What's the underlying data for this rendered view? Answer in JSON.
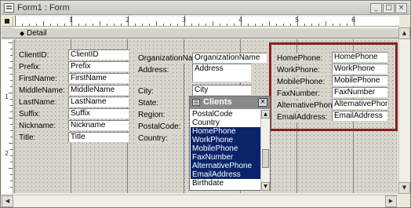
{
  "window": {
    "title": "Form1 : Form",
    "minimize_glyph": "_",
    "maximize_glyph": "□",
    "close_glyph": "×"
  },
  "rulers": {
    "horizontal": [
      "1",
      "2",
      "3",
      "4",
      "5",
      "6"
    ],
    "vertical": [
      "1",
      "2"
    ]
  },
  "section": {
    "arrow_glyph": "◆",
    "label": "Detail"
  },
  "left_fields": [
    {
      "label": "ClientID:",
      "value": "ClientID"
    },
    {
      "label": "Prefix:",
      "value": "Prefix"
    },
    {
      "label": "FirstName:",
      "value": "FirstName"
    },
    {
      "label": "MiddleName:",
      "value": "MiddleName"
    },
    {
      "label": "LastName:",
      "value": "LastName"
    },
    {
      "label": "Suffix:",
      "value": "Suffix"
    },
    {
      "label": "Nickname:",
      "value": "Nickname"
    },
    {
      "label": "Title:",
      "value": "Title"
    }
  ],
  "middle_fields": [
    {
      "label": "OrganizationName:",
      "value": "OrganizationName"
    },
    {
      "label": "Address:",
      "value": "Address"
    },
    {
      "label": "City:",
      "value": "City"
    },
    {
      "label": "State:",
      "value": ""
    },
    {
      "label": "Region:",
      "value": ""
    },
    {
      "label": "PostalCode:",
      "value": ""
    },
    {
      "label": "Country:",
      "value": ""
    }
  ],
  "right_fields": [
    {
      "label": "HomePhone:",
      "value": "HomePhone"
    },
    {
      "label": "WorkPhone:",
      "value": "WorkPhone"
    },
    {
      "label": "MobilePhone:",
      "value": "MobilePhone"
    },
    {
      "label": "FaxNumber:",
      "value": "FaxNumber"
    },
    {
      "label": "AlternativePhone:",
      "value": "AlternativePhone"
    },
    {
      "label": "EmailAddress:",
      "value": "EmailAddress"
    }
  ],
  "field_list": {
    "title": "Clients",
    "close_glyph": "×",
    "items": [
      {
        "name": "PostalCode",
        "selected": false
      },
      {
        "name": "Country",
        "selected": false
      },
      {
        "name": "HomePhone",
        "selected": true
      },
      {
        "name": "WorkPhone",
        "selected": true
      },
      {
        "name": "MobilePhone",
        "selected": true
      },
      {
        "name": "FaxNumber",
        "selected": true
      },
      {
        "name": "AlternativePhone",
        "selected": true
      },
      {
        "name": "EmailAddress",
        "selected": true
      },
      {
        "name": "Birthdate",
        "selected": false
      }
    ]
  },
  "colors": {
    "highlight_border": "#8a1f1f",
    "selection": "#0a246a",
    "grid": "#d8d5cc"
  }
}
